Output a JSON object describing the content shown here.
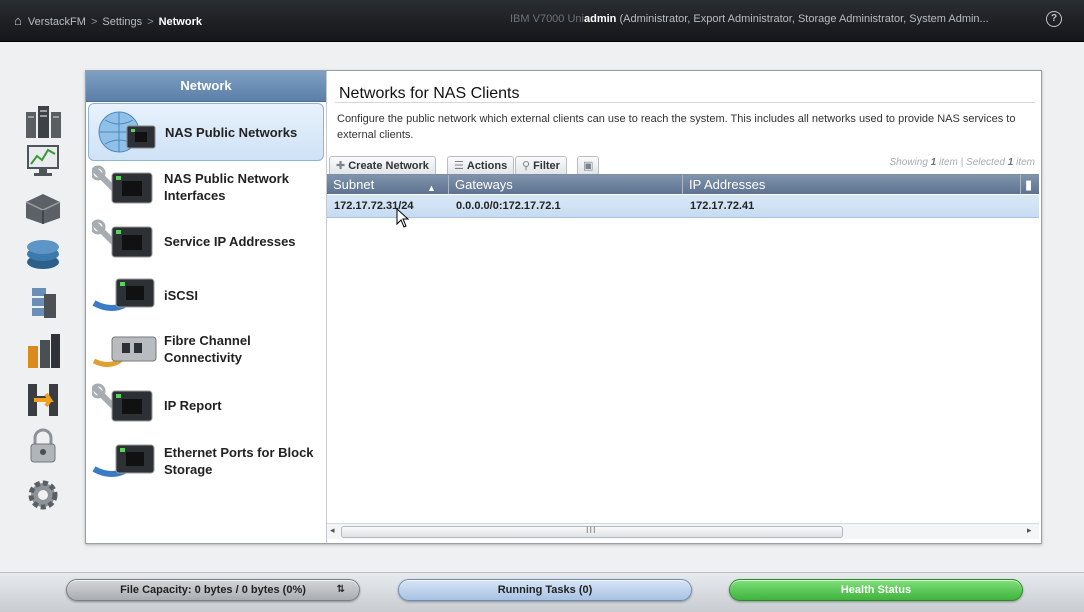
{
  "topbar": {
    "breadcrumb": [
      "VerstackFM",
      "Settings",
      "Network"
    ],
    "system_name": "IBM V7000 Uni",
    "user": "admin",
    "roles": "(Administrator, Export Administrator, Storage Administrator, System Admin..."
  },
  "subnav": {
    "header": "Network",
    "items": [
      {
        "label": "NAS Public Networks",
        "selected": true
      },
      {
        "label": "NAS Public Network Interfaces",
        "selected": false
      },
      {
        "label": "Service IP Addresses",
        "selected": false
      },
      {
        "label": "iSCSI",
        "selected": false
      },
      {
        "label": "Fibre Channel Connectivity",
        "selected": false
      },
      {
        "label": "IP Report",
        "selected": false
      },
      {
        "label": "Ethernet Ports for Block Storage",
        "selected": false
      }
    ]
  },
  "content": {
    "title": "Networks for NAS Clients",
    "description": "Configure the public network which external clients can use to reach the system. This includes all networks used to provide NAS services to external clients."
  },
  "toolbar": {
    "create": "Create Network",
    "actions": "Actions",
    "filter": "Filter",
    "showing_prefix": "Showing",
    "showing_count": "1",
    "showing_mid": "item | Selected",
    "selected_count": "1",
    "showing_suffix": "item"
  },
  "grid": {
    "columns": [
      "Subnet",
      "Gateways",
      "IP Addresses"
    ],
    "sorted_column": "Subnet",
    "rows": [
      {
        "subnet": "172.17.72.31/24",
        "gateways": "0.0.0.0/0:172.17.72.1",
        "ip": "172.17.72.41"
      }
    ],
    "scroll_grip": "III"
  },
  "statusbar": {
    "capacity": "File Capacity: 0 bytes / 0 bytes (0%)",
    "tasks": "Running Tasks (0)",
    "health": "Health Status"
  },
  "colors": {
    "header_blue": "#5d7390",
    "selected_row": "#c7dcf1",
    "health_green": "#3fb33c"
  }
}
